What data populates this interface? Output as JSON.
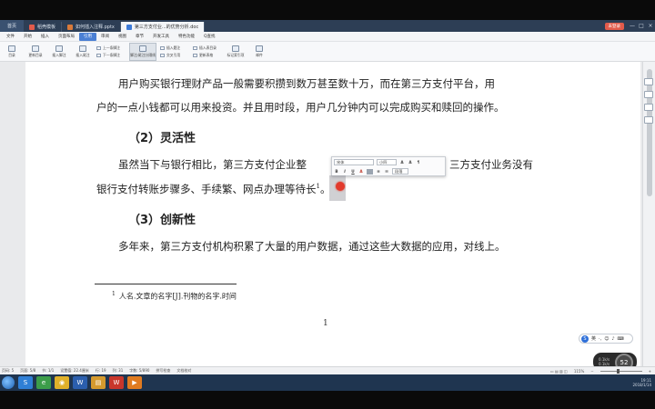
{
  "tabbar": {
    "home": "首页",
    "tabs": [
      {
        "label": "稻壳模板",
        "color": "#e25b4b"
      },
      {
        "label": "如何插入注释.pptx",
        "color": "#d97a3a"
      },
      {
        "label": "第三方支付业...的优势分析.doc",
        "color": "#3d7bd8"
      }
    ],
    "login": "未登录",
    "window_controls": [
      "—",
      "□",
      "×"
    ]
  },
  "menu": {
    "items": [
      "文件",
      "开始",
      "插入",
      "页面布局",
      "引用",
      "审阅",
      "视图",
      "章节",
      "开发工具",
      "特色功能"
    ],
    "active_index": 4,
    "search": "Q查找"
  },
  "ribbon": {
    "buttons": [
      "目录",
      "更新目录",
      "插入脚注",
      "插入尾注",
      "上一条脚注",
      "下一条脚注",
      "脚注/尾注分隔线",
      "插入题注",
      "交叉引用",
      "插入表目录",
      "更新表格",
      "标记索引项",
      "邮件"
    ]
  },
  "document": {
    "lines": [
      "用户购买银行理财产品一般需要积攒到数万甚至数十万，而在第三方支付平台，用",
      "户的一点小钱都可以用来投资。并且用时段，用户几分钟内可以完成购买和赎回的操作。"
    ],
    "heading2": "（2）灵活性",
    "para2_line1_left": "虽然当下与银行相比，第三方支付企业整",
    "para2_line1_right": "三方支付业务没有",
    "para2_line2": "银行支付转账步骤多、手续繁、网点办理等待",
    "para2_line2_tail": "长",
    "para2_superscript": "1",
    "para2_end": "。",
    "heading3": "（3）创新性",
    "para3": "多年来，第三方支付机构积累了大量的用户数据，通过这些大数据的应用，对线上。",
    "footnote_mark": "1",
    "footnote_text": "人名.文章的名字[J].刊物的名字.时间",
    "page_number": "1"
  },
  "mini_toolbar": {
    "font": "宋体",
    "size": "小四",
    "row2": [
      "B",
      "I",
      "U",
      "A"
    ],
    "extra": "段落"
  },
  "ime": {
    "label": "英",
    "extra": "·,"
  },
  "network": {
    "value": "52",
    "up": "0.1k/s",
    "down": "0.1k/s"
  },
  "statusbar": {
    "page": "页码: 5",
    "pages": "页面: 5/8",
    "section": "节: 1/1",
    "settings": "设置值: 22.4厘米",
    "row": "行: 19",
    "col": "列: 31",
    "words": "字数: 5/890",
    "spell": "拼写检查",
    "doc_check": "文档校对",
    "zoom": "115%"
  },
  "taskbar": {
    "time": "19:11",
    "date": "2018/1/14",
    "apps": [
      "start",
      "sogou",
      "browser",
      "chrome",
      "word",
      "explorer",
      "wps",
      "player"
    ]
  },
  "colors": {
    "tab_bar": "#2d3e55",
    "active_menu": "#4a7fd4",
    "cursor": "#e23a2c",
    "taskbar": "#1f3550"
  }
}
